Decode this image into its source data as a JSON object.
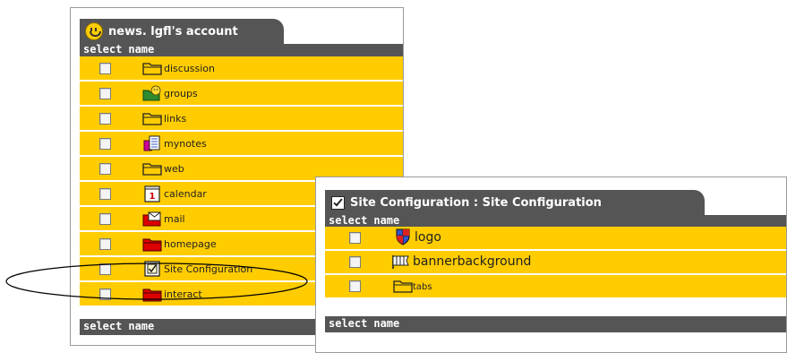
{
  "left_panel": {
    "tab_title": "news. lgfl's account",
    "header": {
      "select": "select",
      "name": "name"
    },
    "footer": {
      "select": "select",
      "name": "name"
    },
    "items": [
      {
        "label": "discussion",
        "icon": "folder-icon"
      },
      {
        "label": "groups",
        "icon": "group-icon"
      },
      {
        "label": "links",
        "icon": "folder-icon"
      },
      {
        "label": "mynotes",
        "icon": "notes-icon"
      },
      {
        "label": "web",
        "icon": "folder-icon"
      },
      {
        "label": "calendar",
        "icon": "calendar-icon"
      },
      {
        "label": "mail",
        "icon": "mail-icon"
      },
      {
        "label": "homepage",
        "icon": "red-folder-icon"
      },
      {
        "label": "Site Configuration",
        "icon": "site-config-icon"
      },
      {
        "label": "interact",
        "icon": "red-folder-icon"
      }
    ]
  },
  "right_panel": {
    "tab_title": "Site Configuration : Site Configuration",
    "header": {
      "select": "select",
      "name": "name"
    },
    "footer": {
      "select": "select",
      "name": "name"
    },
    "items": [
      {
        "label": "logo",
        "icon": "shield-icon"
      },
      {
        "label": "bannerbackground",
        "icon": "banner-icon"
      },
      {
        "label": "tabs",
        "icon": "folder-icon"
      }
    ]
  },
  "calendar_day": "1",
  "colors": {
    "row_bg": "#ffcc00",
    "bar_bg": "#555555",
    "highlight_ellipse": "#000000"
  }
}
